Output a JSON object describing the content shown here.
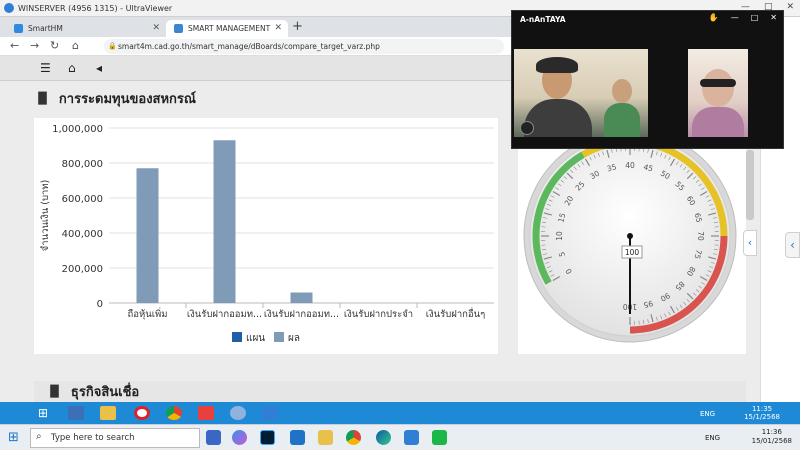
{
  "outer_window": {
    "title": "WINSERVER (4956 1315) - UltraViewer"
  },
  "browser": {
    "tabs": [
      {
        "label": "SmartHM",
        "color": "#2f8be0"
      },
      {
        "label": "SMART MANAGEMENT",
        "color": "#3a86d1"
      }
    ],
    "new_tab": "+",
    "url": "smart4m.cad.go.th/smart_manage/dBoards/compare_target_varz.php"
  },
  "page": {
    "toolbar": {
      "menu_icon": "☰",
      "home_icon": "⌂",
      "back_icon": "◂"
    },
    "section1_title": "การระดมทุนของสหกรณ์",
    "section2_title": "ธุรกิจสินเชื่อ"
  },
  "chart_data": {
    "type": "bar",
    "categories": [
      "ถือหุ้นเพิ่ม",
      "เงินรับฝากออมท...",
      "เงินรับฝากออมท...",
      "เงินรับฝากประจำ",
      "เงินรับฝากอื่นๆ"
    ],
    "series": [
      {
        "name": "แผน",
        "color": "#1f5fa6",
        "values": [
          0,
          0,
          0,
          0,
          0
        ]
      },
      {
        "name": "ผล",
        "color": "#7f9bb7",
        "values": [
          770000,
          930000,
          60000,
          0,
          0
        ]
      }
    ],
    "ylabel": "จำนวนเงิน (บาท)",
    "ylim": [
      0,
      1000000
    ],
    "yticks": [
      "0",
      "200,000",
      "400,000",
      "600,000",
      "800,000",
      "1,000,000"
    ],
    "grid": true,
    "legend": "bottom"
  },
  "gauge": {
    "value": 100,
    "value_label": "100",
    "min": 0,
    "max": 100,
    "ticks": [
      "0",
      "5",
      "10",
      "15",
      "20",
      "25",
      "30",
      "35",
      "40",
      "45",
      "50",
      "55",
      "60",
      "65",
      "70",
      "75",
      "80",
      "85",
      "90",
      "95",
      "100"
    ],
    "bands": [
      {
        "from": 0,
        "to": 30,
        "color": "#5cb85c"
      },
      {
        "from": 30,
        "to": 70,
        "color": "#e6c229"
      },
      {
        "from": 70,
        "to": 100,
        "color": "#d9534f"
      }
    ]
  },
  "video_call": {
    "title": "A-nAnTAYA",
    "buttons": [
      "✋",
      "—",
      "□",
      "✕"
    ]
  },
  "remote_taskbar": {
    "lang": "ENG",
    "time": "11:35",
    "date": "15/1/2568"
  },
  "local_taskbar": {
    "search_placeholder": "Type here to search",
    "lang": "ENG",
    "time": "11:36",
    "date": "15/01/2568"
  }
}
